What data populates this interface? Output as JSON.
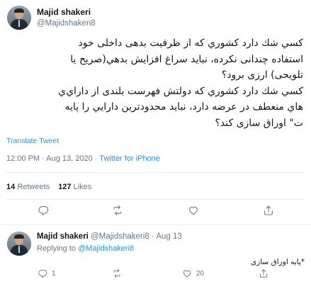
{
  "main_tweet": {
    "author_name": "Majid shakeri",
    "author_handle": "@Majidshakeri8",
    "text_lines": [
      "کسي شك دارد کشوري که از ظرفيت بدهی داخلی خود",
      "استفاده چندانی نکرده، نبايد سراغ افزايش بدهي(صريح يا",
      "تلويحی) ارزی برود؟",
      "کسي شك دارد کشوري که دولتش فهرست بلندی از داراي‌ي",
      "هاي منعطف در عرضه دارد، نبايد محدودترين دارايي را پايه",
      "ت\" اوراق سازی کند؟"
    ],
    "translate_label": "Translate Tweet",
    "time": "12:00 PM",
    "date": "Aug 13, 2020",
    "source": "Twitter for iPhone",
    "retweets_count": "14",
    "retweets_label": "Retweets",
    "likes_count": "127",
    "likes_label": "Likes"
  },
  "reply_tweet": {
    "author_name": "Majid shakeri",
    "author_handle": "@Majidshakeri8",
    "date": "Aug 13",
    "replying_label": "Replying to",
    "replying_to": "@Majidshakeri8",
    "text": "*پايه اوراق سازی",
    "reply_count": "1",
    "retweet_count": "",
    "like_count": "20"
  },
  "icons": {
    "reply": "reply-icon",
    "retweet": "retweet-icon",
    "like": "heart-icon",
    "share": "share-icon"
  }
}
